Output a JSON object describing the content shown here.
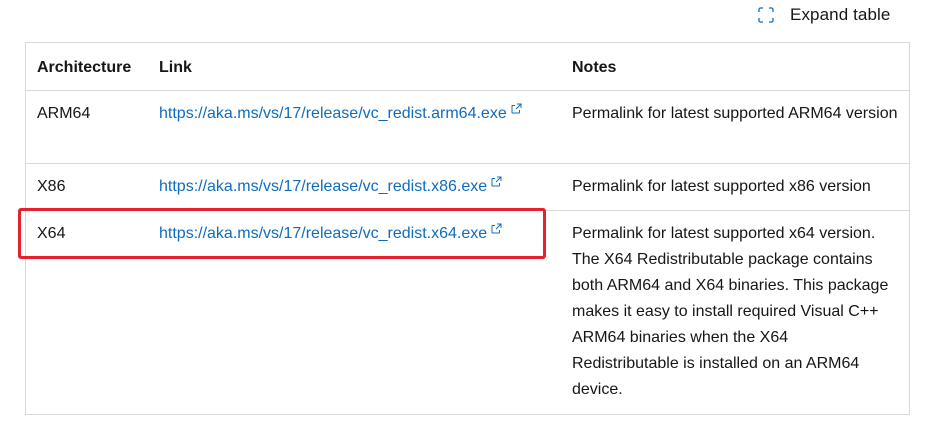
{
  "toolbar": {
    "expand_label": "Expand table",
    "expand_icon": "expand-icon"
  },
  "table": {
    "headers": [
      "Architecture",
      "Link",
      "Notes"
    ],
    "rows": [
      {
        "architecture": "ARM64",
        "link": "https://aka.ms/vs/17/release/vc_redist.arm64.exe",
        "notes": "Permalink for latest supported ARM64 version"
      },
      {
        "architecture": "X86",
        "link": "https://aka.ms/vs/17/release/vc_redist.x86.exe",
        "notes": "Permalink for latest supported x86 version"
      },
      {
        "architecture": "X64",
        "link": "https://aka.ms/vs/17/release/vc_redist.x64.exe",
        "notes": "Permalink for latest supported x64 version. The X64 Redistributable package contains both ARM64 and X64 binaries. This package makes it easy to install required Visual C++ ARM64 binaries when the X64 Redistributable is installed on an ARM64 device."
      }
    ]
  },
  "colors": {
    "link": "#0f6cbd",
    "highlight": "#e6212e",
    "border": "#d9d9d9",
    "text": "#161616"
  },
  "icons": {
    "external_link": "external-link-icon"
  }
}
